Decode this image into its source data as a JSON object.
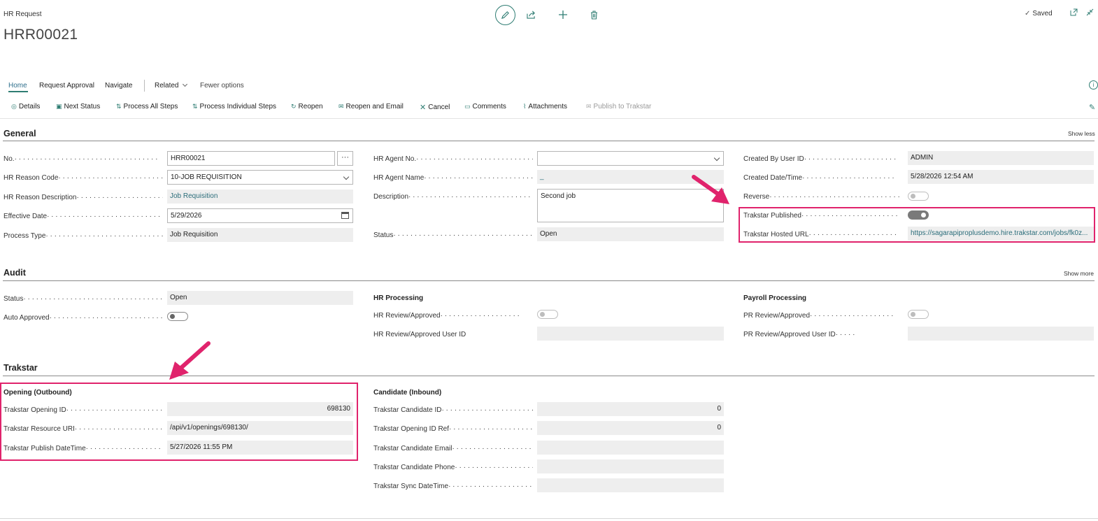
{
  "header": {
    "page_kind": "HR Request",
    "page_title": "HRR00021",
    "saved_label": "Saved"
  },
  "menu": {
    "home": "Home",
    "request_approval": "Request Approval",
    "navigate": "Navigate",
    "related": "Related",
    "fewer_options": "Fewer options"
  },
  "actions": {
    "details": "Details",
    "next_status": "Next Status",
    "process_all_steps": "Process All Steps",
    "process_individual_steps": "Process Individual Steps",
    "reopen": "Reopen",
    "reopen_and_email": "Reopen and Email",
    "cancel": "Cancel",
    "comments": "Comments",
    "attachments": "Attachments",
    "publish_to_trakstar": "Publish to Trakstar"
  },
  "general": {
    "title": "General",
    "toggle": "Show less",
    "no_label": "No.",
    "no_value": "HRR00021",
    "ellipsis": "···",
    "reason_code_label": "HR Reason Code",
    "reason_code_value": "10-JOB REQUISITION",
    "reason_desc_label": "HR Reason Description",
    "reason_desc_value": "Job Requisition",
    "effective_date_label": "Effective Date",
    "effective_date_value": "5/29/2026",
    "process_type_label": "Process Type",
    "process_type_value": "Job Requisition",
    "agent_no_label": "HR Agent No.",
    "agent_no_value": "",
    "agent_name_label": "HR Agent Name",
    "agent_name_value": "_",
    "description_label": "Description",
    "description_value": "Second job",
    "status_label": "Status",
    "status_value": "Open",
    "created_by_label": "Created By User ID",
    "created_by_value": "ADMIN",
    "created_date_label": "Created Date/Time",
    "created_date_value": "5/28/2026 12:54 AM",
    "reverse_label": "Reverse",
    "reverse_on": false,
    "trakstar_published_label": "Trakstar Published",
    "trakstar_published_on": true,
    "trakstar_url_label": "Trakstar Hosted URL",
    "trakstar_url_value": "https://sagarapiproplusdemo.hire.trakstar.com/jobs/fk0z..."
  },
  "audit": {
    "title": "Audit",
    "toggle": "Show more",
    "status_label": "Status",
    "status_value": "Open",
    "auto_approved_label": "Auto Approved",
    "auto_approved_on": false,
    "hr_processing_title": "HR Processing",
    "hr_review_label": "HR Review/Approved",
    "hr_review_on": false,
    "hr_review_user_label": "HR Review/Approved User ID",
    "hr_review_user_value": "",
    "payroll_processing_title": "Payroll Processing",
    "pr_review_label": "PR Review/Approved",
    "pr_review_on": false,
    "pr_review_user_label": "PR Review/Approved User ID",
    "pr_review_user_value": ""
  },
  "trakstar": {
    "title": "Trakstar",
    "opening_title": "Opening (Outbound)",
    "opening_id_label": "Trakstar Opening ID",
    "opening_id_value": "698130",
    "resource_uri_label": "Trakstar Resource URI",
    "resource_uri_value": "/api/v1/openings/698130/",
    "publish_dt_label": "Trakstar Publish DateTime",
    "publish_dt_value": "5/27/2026 11:55 PM",
    "candidate_title": "Candidate (Inbound)",
    "candidate_id_label": "Trakstar Candidate ID",
    "candidate_id_value": "0",
    "opening_ref_label": "Trakstar Opening ID Ref",
    "opening_ref_value": "0",
    "candidate_email_label": "Trakstar Candidate Email",
    "candidate_email_value": "",
    "candidate_phone_label": "Trakstar Candidate Phone",
    "candidate_phone_value": "",
    "sync_dt_label": "Trakstar Sync DateTime",
    "sync_dt_value": ""
  },
  "colors": {
    "accent": "#2f7d73",
    "highlight": "#e0236c",
    "readonly_bg": "#eeeeee"
  }
}
